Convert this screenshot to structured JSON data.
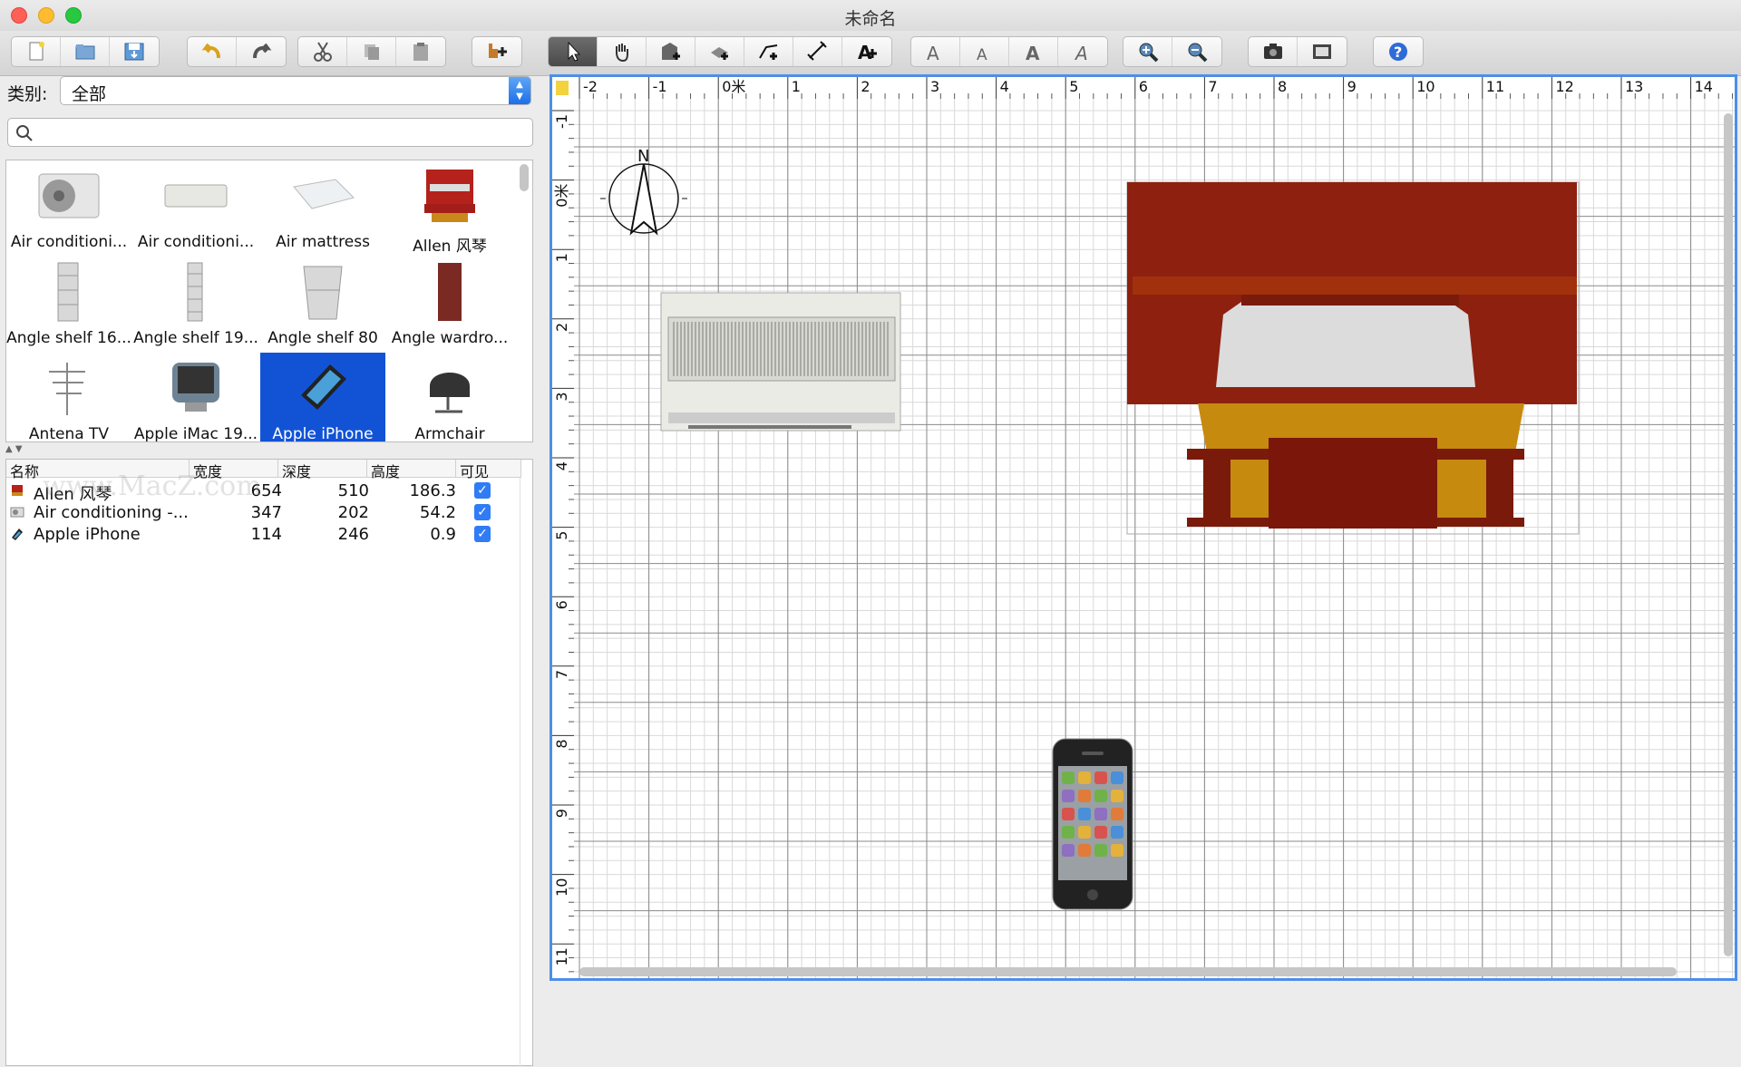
{
  "window": {
    "title": "未命名"
  },
  "toolbar": {
    "groups": [
      {
        "buttons": [
          "new-file-icon",
          "open-file-icon",
          "save-file-icon"
        ]
      },
      {
        "buttons": [
          "undo-icon",
          "redo-icon"
        ]
      },
      {
        "buttons": [
          "cut-icon",
          "copy-icon",
          "paste-icon"
        ]
      },
      {
        "buttons": [
          "add-furniture-icon"
        ]
      },
      {
        "buttons": [
          "select-arrow-icon",
          "pan-hand-icon",
          "create-walls-icon",
          "create-rooms-icon",
          "create-polylines-icon",
          "create-dimensions-icon",
          "add-text-icon"
        ]
      },
      {
        "buttons": [
          "increase-text-size-icon",
          "decrease-text-size-icon",
          "bold-text-icon",
          "italic-text-icon"
        ]
      },
      {
        "buttons": [
          "zoom-in-icon",
          "zoom-out-icon"
        ]
      },
      {
        "buttons": [
          "create-photo-icon",
          "create-video-icon"
        ]
      },
      {
        "buttons": [
          "help-icon"
        ]
      }
    ],
    "active": "select-arrow-icon"
  },
  "catalog": {
    "category_label": "类别:",
    "category_value": "全部",
    "search_placeholder": "",
    "items": [
      {
        "label": "Air conditioni...",
        "icon": "air-conditioner-outdoor-icon"
      },
      {
        "label": "Air conditioni...",
        "icon": "air-conditioner-indoor-icon"
      },
      {
        "label": "Air mattress",
        "icon": "air-mattress-icon"
      },
      {
        "label": "Allen 风琴",
        "icon": "organ-icon"
      },
      {
        "label": "Angle shelf 16...",
        "icon": "angle-shelf-icon"
      },
      {
        "label": "Angle shelf 19...",
        "icon": "angle-shelf-icon"
      },
      {
        "label": "Angle shelf 80",
        "icon": "angle-shelf-icon"
      },
      {
        "label": "Angle wardro...",
        "icon": "wardrobe-icon"
      },
      {
        "label": "Antena TV",
        "icon": "tv-antenna-icon"
      },
      {
        "label": "Apple iMac 19...",
        "icon": "imac-icon"
      },
      {
        "label": "Apple iPhone",
        "icon": "iphone-icon",
        "selected": true
      },
      {
        "label": "Armchair",
        "icon": "armchair-icon"
      }
    ]
  },
  "furniture_table": {
    "headers": {
      "name": "名称",
      "width": "宽度",
      "depth": "深度",
      "height": "高度",
      "visible": "可见"
    },
    "watermark": "www.MacZ.com",
    "rows": [
      {
        "name": "Allen 风琴",
        "width": "654",
        "depth": "510",
        "height": "186.3",
        "visible": true,
        "icon": "organ-icon"
      },
      {
        "name": "Air conditioning -...",
        "width": "347",
        "depth": "202",
        "height": "54.2",
        "visible": true,
        "icon": "air-conditioner-icon"
      },
      {
        "name": "Apple iPhone",
        "width": "114",
        "depth": "246",
        "height": "0.9",
        "visible": true,
        "icon": "iphone-icon"
      }
    ]
  },
  "plan": {
    "h_ruler": [
      "-2",
      "-1",
      "0米",
      "1",
      "2",
      "3",
      "4",
      "5",
      "6",
      "7",
      "8",
      "9",
      "10",
      "11",
      "12",
      "13",
      "14"
    ],
    "v_ruler": [
      "-1",
      "0米",
      "1",
      "2",
      "3",
      "4",
      "5",
      "6",
      "7",
      "8",
      "9",
      "10",
      "11"
    ],
    "compass_label": "N",
    "accent": "#4e8ee8"
  }
}
